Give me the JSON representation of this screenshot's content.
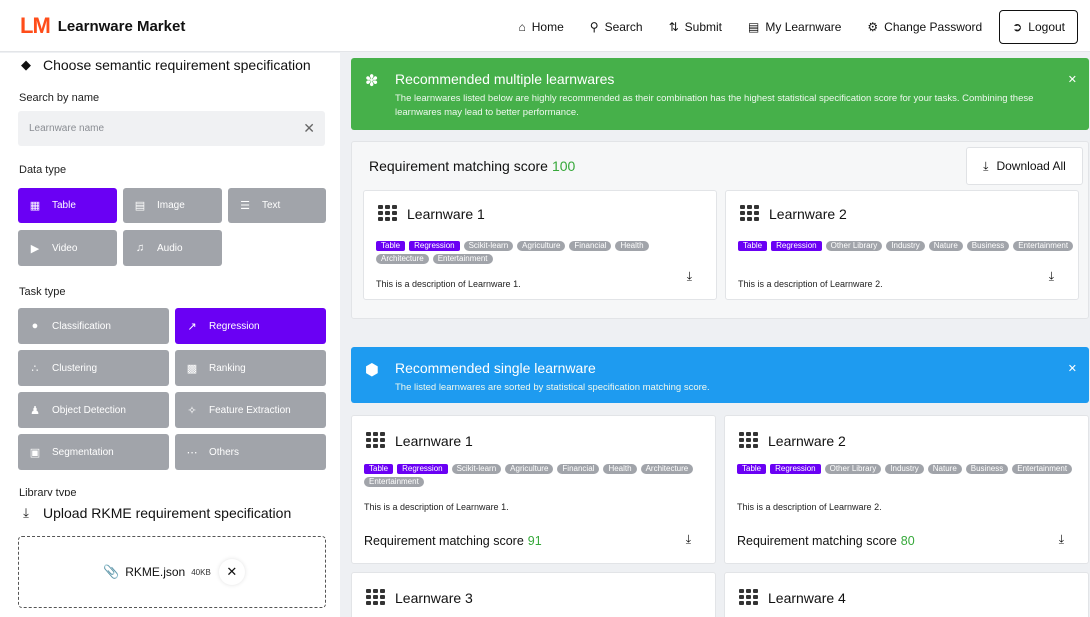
{
  "header": {
    "logo_mark": "LM",
    "logo_text": "Learnware Market",
    "nav": [
      {
        "label": "Home",
        "icon": "home-icon"
      },
      {
        "label": "Search",
        "icon": "search-icon"
      },
      {
        "label": "Submit",
        "icon": "submit-icon"
      },
      {
        "label": "My Learnware",
        "icon": "document-icon"
      },
      {
        "label": "Change Password",
        "icon": "user-key-icon"
      },
      {
        "label": "Logout",
        "icon": "logout-icon"
      }
    ]
  },
  "sidebar": {
    "semantic_title": "Choose semantic requirement specification",
    "search_label": "Search by name",
    "search_placeholder": "Learnware name",
    "data_type_label": "Data type",
    "data_types": [
      {
        "label": "Table",
        "active": true
      },
      {
        "label": "Image",
        "active": false
      },
      {
        "label": "Text",
        "active": false
      },
      {
        "label": "Video",
        "active": false
      },
      {
        "label": "Audio",
        "active": false
      }
    ],
    "task_type_label": "Task type",
    "task_types": [
      {
        "label": "Classification",
        "active": false
      },
      {
        "label": "Regression",
        "active": true
      },
      {
        "label": "Clustering",
        "active": false
      },
      {
        "label": "Ranking",
        "active": false
      },
      {
        "label": "Object Detection",
        "active": false
      },
      {
        "label": "Feature Extraction",
        "active": false
      },
      {
        "label": "Segmentation",
        "active": false
      },
      {
        "label": "Others",
        "active": false
      }
    ],
    "library_type_label": "Library type",
    "upload_title": "Upload RKME requirement specification",
    "file_name": "RKME.json",
    "file_size": "40KB"
  },
  "multi_alert": {
    "title": "Recommended multiple learnwares",
    "description": "The learnwares listed below are highly recommended as their combination has the highest statistical specification score for your tasks. Combining these learnwares may lead to better performance.",
    "color": "#46b04a"
  },
  "multi_panel": {
    "score_label": "Requirement matching score",
    "score": "100",
    "download_all": "Download All"
  },
  "multi_cards": [
    {
      "title": "Learnware 1",
      "tags": [
        "Table",
        "Regression",
        "Scikit-learn",
        "Agriculture",
        "Financial",
        "Health",
        "Architecture",
        "Entertainment"
      ],
      "description": "This is a description of Learnware 1."
    },
    {
      "title": "Learnware 2",
      "tags": [
        "Table",
        "Regression",
        "Other Library",
        "Industry",
        "Nature",
        "Business",
        "Entertainment"
      ],
      "description": "This is a description of Learnware 2."
    }
  ],
  "single_alert": {
    "title": "Recommended single learnware",
    "description": "The listed learnwares are sorted by statistical specification matching score.",
    "color": "#1e9bf0"
  },
  "single_cards": [
    {
      "title": "Learnware 1",
      "tags": [
        "Table",
        "Regression",
        "Scikit-learn",
        "Agriculture",
        "Financial",
        "Health",
        "Architecture",
        "Entertainment"
      ],
      "description": "This is a description of Learnware 1.",
      "score_label": "Requirement matching score",
      "score": "91"
    },
    {
      "title": "Learnware 2",
      "tags": [
        "Table",
        "Regression",
        "Other Library",
        "Industry",
        "Nature",
        "Business",
        "Entertainment"
      ],
      "description": "This is a description of Learnware 2.",
      "score_label": "Requirement matching score",
      "score": "80"
    },
    {
      "title": "Learnware 3"
    },
    {
      "title": "Learnware 4"
    }
  ],
  "colors": {
    "accent_purple": "#6a00f4",
    "chip_gray": "#a1a4aa",
    "score_green": "#36a83a",
    "logo_orange": "#ff4d1a"
  }
}
